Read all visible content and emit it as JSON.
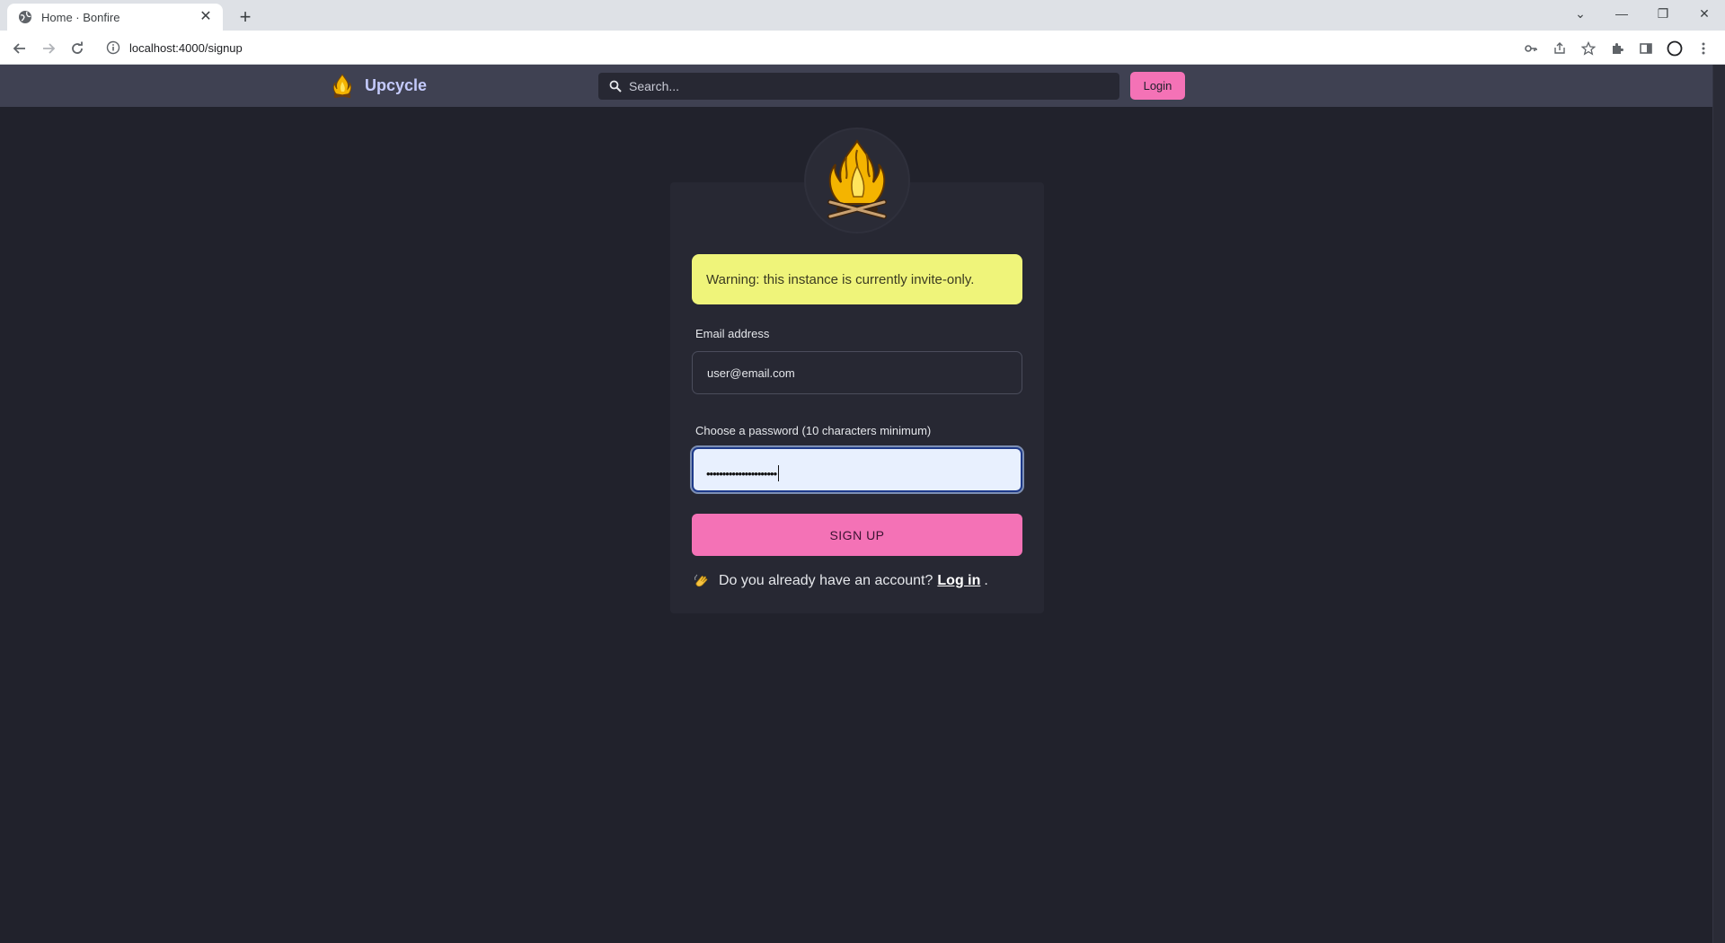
{
  "browser": {
    "tab_title": "Home · Bonfire",
    "tab_close": "✕",
    "new_tab": "+",
    "url": "localhost:4000/signup",
    "window_controls": [
      "⌄",
      "—",
      "❐",
      "✕"
    ]
  },
  "header": {
    "brand_name": "Upcycle",
    "search_placeholder": "Search...",
    "login_label": "Login"
  },
  "signup": {
    "warning": "Warning: this instance is currently invite-only.",
    "email_label": "Email address",
    "email_value": "user@email.com",
    "password_label": "Choose a password (10 characters minimum)",
    "password_mask": "••••••••••••••••••••••",
    "submit_label": "SIGN UP",
    "footer_text": "Do you already have an account?",
    "footer_link": "Log in",
    "footer_end": "."
  },
  "colors": {
    "accent_pink": "#f472b6",
    "warning_yellow": "#eff47a",
    "page_bg": "#21222c",
    "header_bg": "#3f4152"
  },
  "icons": [
    "globe-icon",
    "back-icon",
    "forward-icon",
    "reload-icon",
    "info-icon",
    "key-icon",
    "share-icon",
    "star-icon",
    "extensions-icon",
    "sidepanel-icon",
    "profile-icon",
    "menu-icon",
    "bonfire-logo",
    "search-icon",
    "wave-hand-icon"
  ]
}
